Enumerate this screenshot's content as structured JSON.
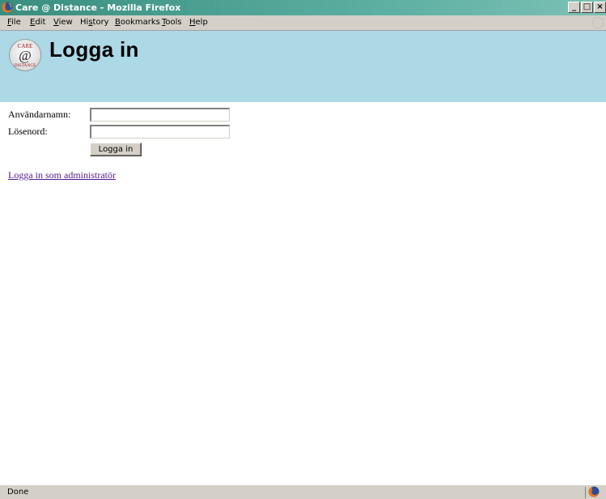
{
  "window": {
    "title": "Care @ Distance - Mozilla Firefox",
    "icon": "firefox-icon",
    "buttons": {
      "minimize": "_",
      "maximize": "□",
      "close": "×"
    }
  },
  "menubar": {
    "items": [
      {
        "label_prefix": "",
        "accel": "F",
        "label_rest": "ile"
      },
      {
        "label_prefix": "",
        "accel": "E",
        "label_rest": "dit"
      },
      {
        "label_prefix": "",
        "accel": "V",
        "label_rest": "iew"
      },
      {
        "label_prefix": "Hi",
        "accel": "s",
        "label_rest": "tory"
      },
      {
        "label_prefix": "",
        "accel": "B",
        "label_rest": "ookmarks"
      },
      {
        "label_prefix": "",
        "accel": "T",
        "label_rest": "ools"
      },
      {
        "label_prefix": "",
        "accel": "H",
        "label_rest": "elp"
      }
    ]
  },
  "header": {
    "logo": {
      "top_text": "CARE",
      "symbol": "@",
      "bottom_text": "DISTANCE"
    },
    "title": "Logga in",
    "background_color": "#add8e6"
  },
  "login_form": {
    "username_label": "Användarnamn:",
    "username_value": "",
    "password_label": "Lösenord:",
    "password_value": "",
    "submit_label": "Logga in"
  },
  "admin_link": {
    "label": "Logga in som administratör",
    "color": "#551a8b"
  },
  "statusbar": {
    "text": "Done",
    "icon": "firefox-status-icon"
  }
}
